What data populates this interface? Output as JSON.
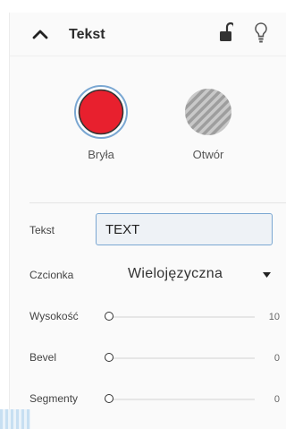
{
  "header": {
    "title": "Tekst",
    "collapse_icon": "chevron-up-icon",
    "lock_icon": "unlocked-padlock-icon",
    "hint_icon": "lightbulb-icon"
  },
  "modes": [
    {
      "label": "Bryła",
      "icon": "solid-red-circle",
      "color": "#e8202e",
      "selected": true
    },
    {
      "label": "Otwór",
      "icon": "striped-hole-circle",
      "color": "#b3b3b3",
      "selected": false
    }
  ],
  "properties": {
    "text": {
      "label": "Tekst",
      "value": "TEXT"
    },
    "font": {
      "label": "Czcionka",
      "value": "Wielojęzyczna"
    },
    "height": {
      "label": "Wysokość",
      "value": "10",
      "level": 0
    },
    "bevel": {
      "label": "Bevel",
      "value": "0",
      "level": 0
    },
    "segments": {
      "label": "Segmenty",
      "value": "0",
      "level": 0
    }
  },
  "colors": {
    "accent_blue": "#7aa7d2",
    "solid_red": "#e8202e",
    "hole_gray": "#b3b3b3"
  }
}
